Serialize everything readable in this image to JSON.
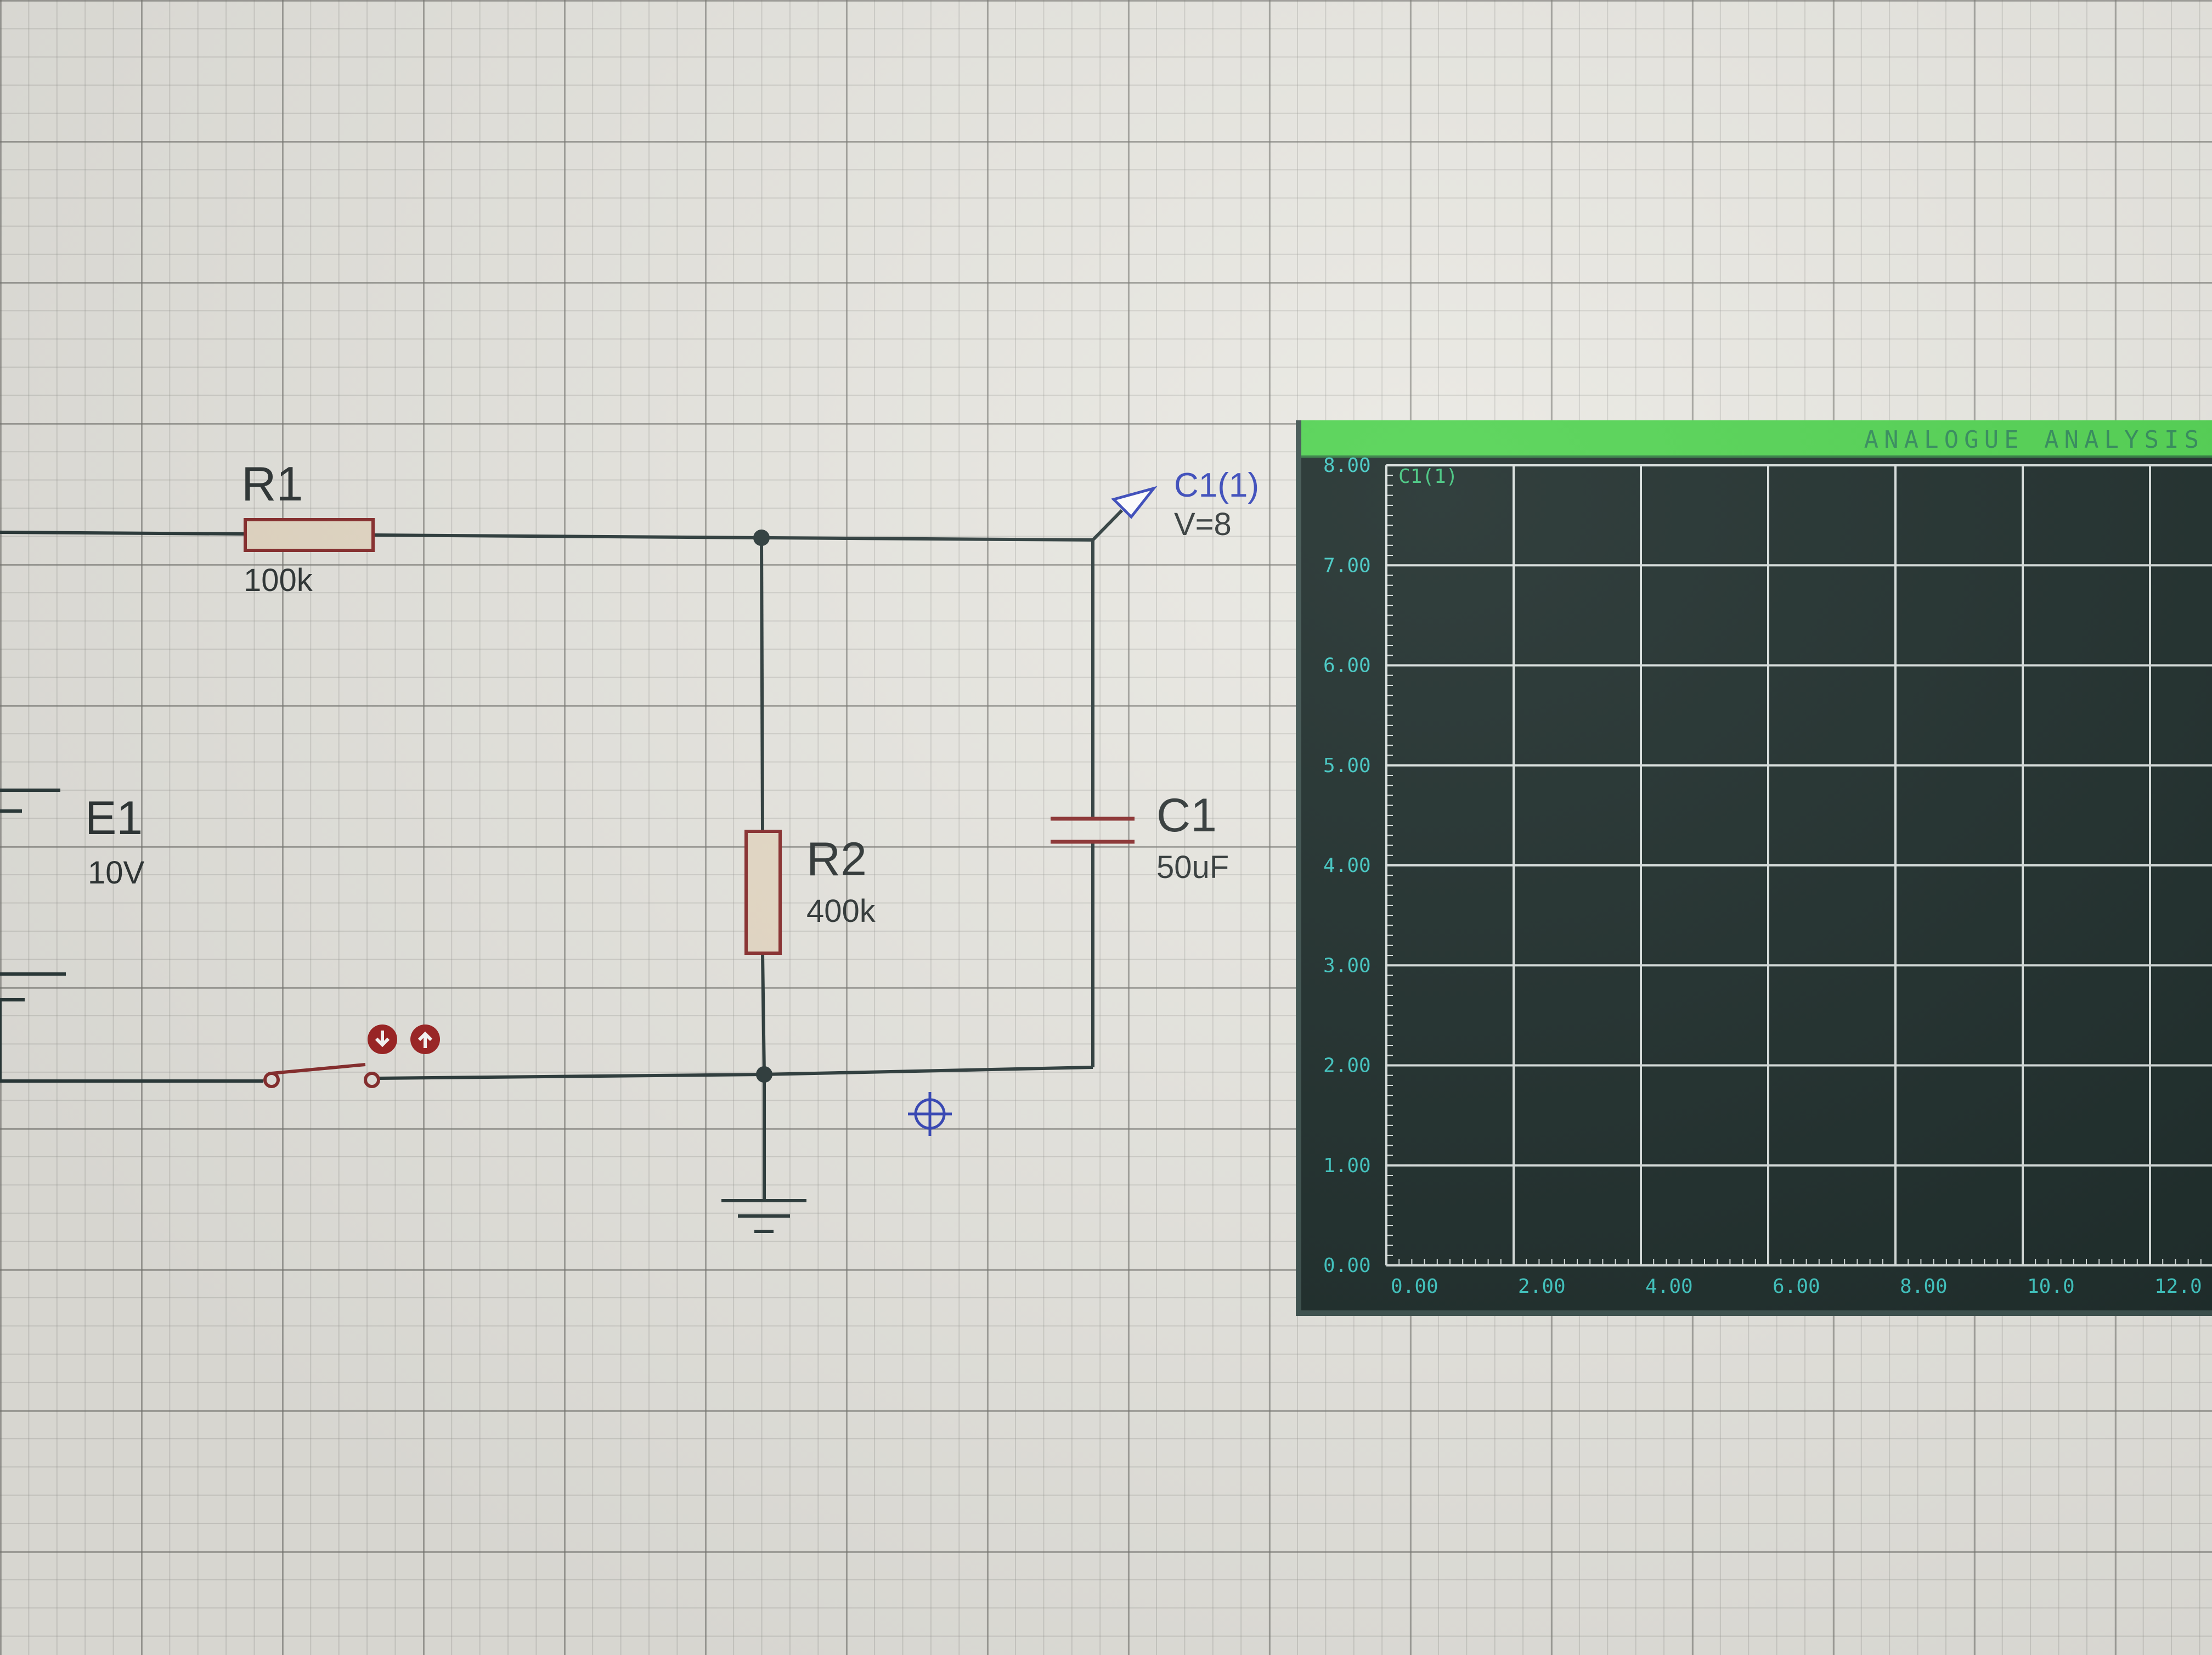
{
  "window": {
    "title": ""
  },
  "components": {
    "r1": {
      "name": "R1",
      "value": "100k"
    },
    "r2": {
      "name": "R2",
      "value": "400k"
    },
    "c1": {
      "name": "C1",
      "value": "50uF"
    },
    "e1": {
      "name": "E1",
      "value": "10V"
    }
  },
  "probe": {
    "name": "C1(1)",
    "reading": "V=8"
  },
  "graph": {
    "title": "ANALOGUE ANALYSIS",
    "trace_label": "C1(1)",
    "y_ticks": [
      "8.00",
      "7.00",
      "6.00",
      "5.00",
      "4.00",
      "3.00",
      "2.00",
      "1.00",
      "0.00"
    ],
    "x_ticks": [
      "0.00",
      "2.00",
      "4.00",
      "6.00",
      "8.00",
      "10.0",
      "12.0"
    ]
  },
  "colors": {
    "wire": "#2b3a3a",
    "component_outline": "#8a2d2d",
    "component_fill": "#e8dcc8",
    "probe_text": "#3344b8",
    "graph_bg": "#1b2a28",
    "graph_grid": "#d9e0de",
    "graph_titlebar": "#4fd24f",
    "axis_text": "#3ec7c2"
  },
  "icons": {
    "switch_buttons": [
      "arrow-down-icon",
      "arrow-up-icon"
    ],
    "cursor": "crosshair-icon"
  }
}
